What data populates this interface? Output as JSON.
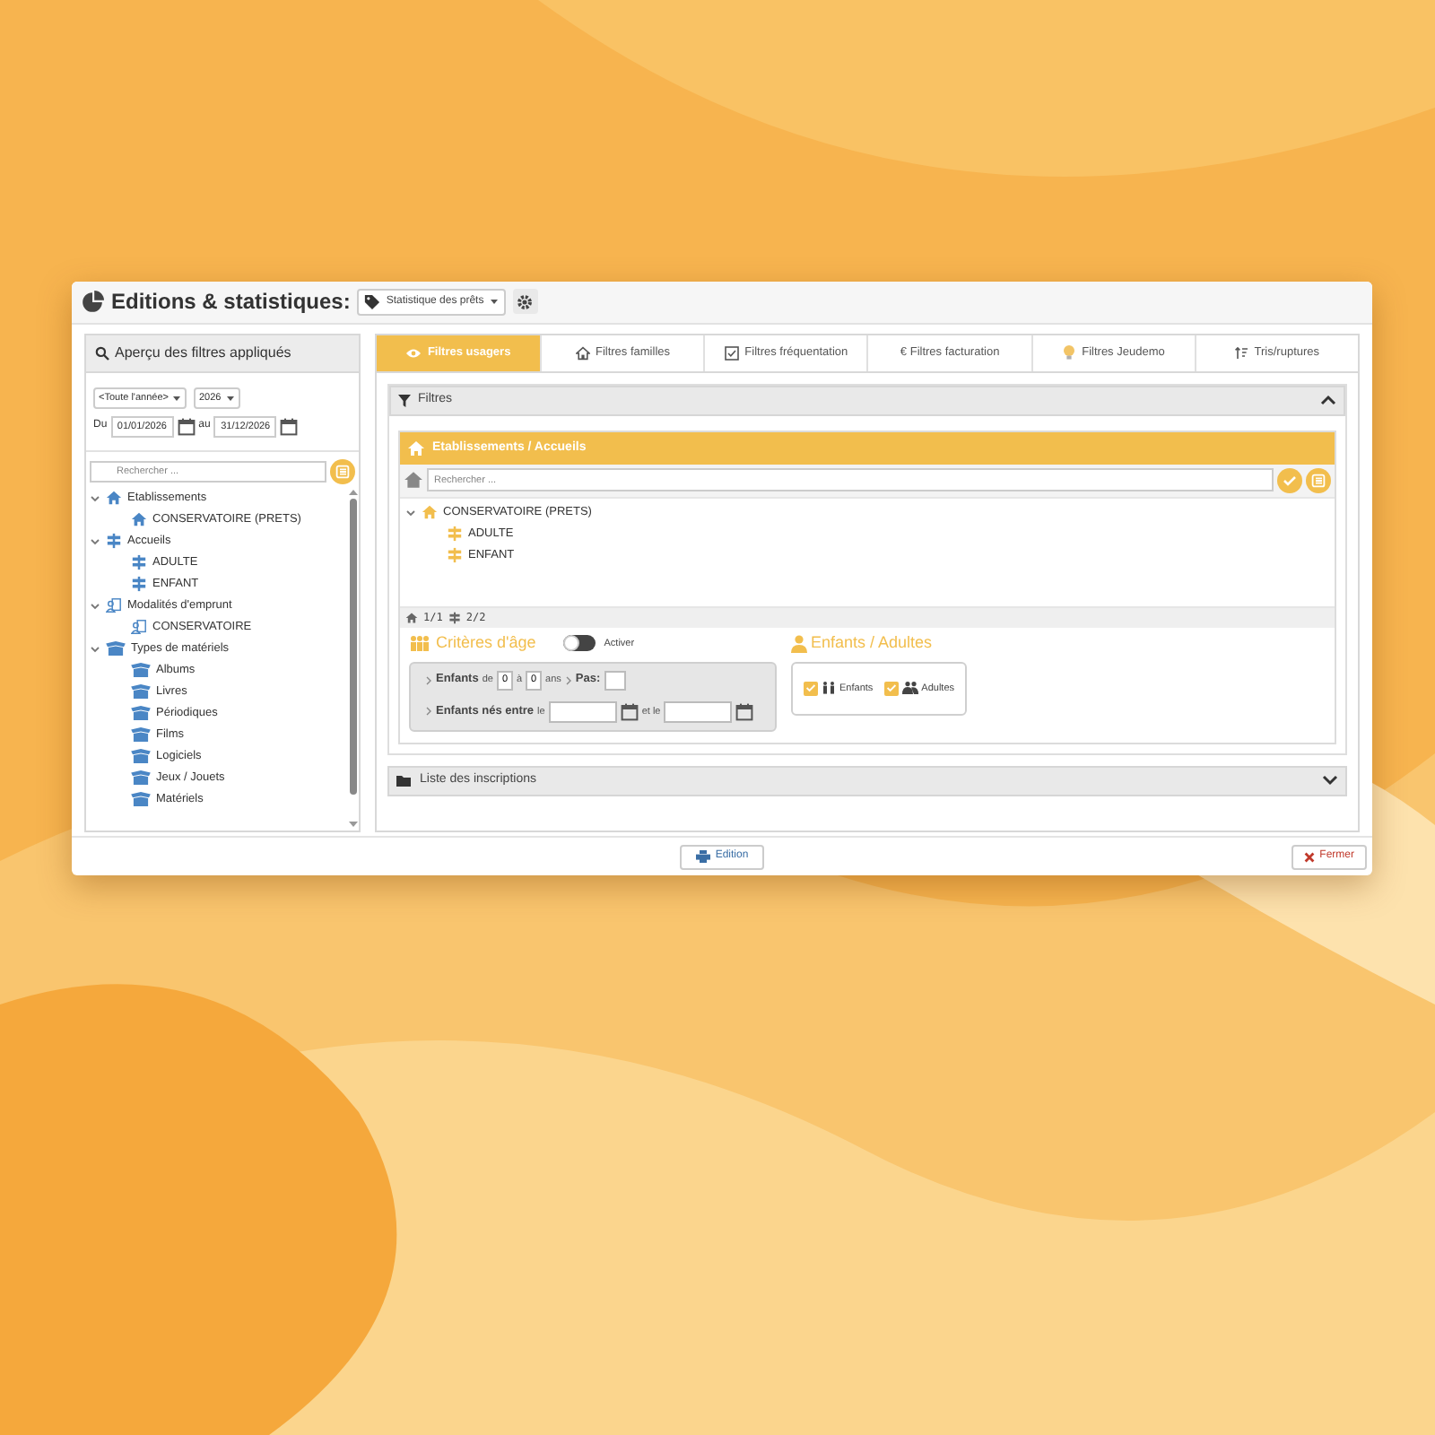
{
  "window": {
    "title": "Editions & statistiques:"
  },
  "report_select": {
    "value": "Statistique des prêts"
  },
  "filters_panel": {
    "title": "Aperçu des filtres appliqués",
    "period_select": {
      "value": "<Toute l'année>"
    },
    "year_select": {
      "value": "2026"
    },
    "from_label": "Du",
    "from_date": {
      "value": "01/01/2026"
    },
    "to_label": "au",
    "to_date": {
      "value": "31/12/2026"
    },
    "search": {
      "placeholder": "Rechercher ..."
    },
    "tree": [
      {
        "label": "Etablissements",
        "kind": "site",
        "expanded": true,
        "children": [
          {
            "label": "CONSERVATOIRE (PRETS)",
            "kind": "site"
          }
        ]
      },
      {
        "label": "Accueils",
        "kind": "reception",
        "expanded": true,
        "children": [
          {
            "label": "ADULTE",
            "kind": "reception"
          },
          {
            "label": "ENFANT",
            "kind": "reception"
          }
        ]
      },
      {
        "label": "Modalités d'emprunt",
        "kind": "loan",
        "expanded": true,
        "children": [
          {
            "label": "CONSERVATOIRE",
            "kind": "loan"
          }
        ]
      },
      {
        "label": "Types de matériels",
        "kind": "material",
        "expanded": true,
        "children": [
          {
            "label": "Albums",
            "kind": "material"
          },
          {
            "label": "Livres",
            "kind": "material"
          },
          {
            "label": "Périodiques",
            "kind": "material"
          },
          {
            "label": "Films",
            "kind": "material"
          },
          {
            "label": "Logiciels",
            "kind": "material"
          },
          {
            "label": "Jeux / Jouets",
            "kind": "material"
          },
          {
            "label": "Matériels",
            "kind": "material"
          }
        ]
      }
    ]
  },
  "tabs": [
    {
      "label": "Filtres usagers",
      "kind": "eye",
      "selected": true
    },
    {
      "label": "Filtres familles",
      "kind": "house",
      "selected": false
    },
    {
      "label": "Filtres fréquentation",
      "kind": "check",
      "selected": false
    },
    {
      "label": "€ Filtres facturation",
      "kind": "text",
      "selected": false
    },
    {
      "label": "Filtres Jeudemo",
      "kind": "bulb",
      "selected": false
    },
    {
      "label": "Tris/ruptures",
      "kind": "sort",
      "selected": false
    }
  ],
  "filters_section": {
    "title": "Filtres",
    "expanded": true
  },
  "establishments": {
    "title": "Etablissements / Accueils",
    "search": {
      "placeholder": "Rechercher ..."
    },
    "tree": [
      {
        "label": "CONSERVATOIRE (PRETS)",
        "kind": "site",
        "expanded": true,
        "children": [
          {
            "label": "ADULTE",
            "kind": "reception"
          },
          {
            "label": "ENFANT",
            "kind": "reception"
          }
        ]
      }
    ],
    "counts": [
      {
        "kind": "site",
        "text": "1/1"
      },
      {
        "kind": "reception",
        "text": "2/2"
      }
    ]
  },
  "age_criteria": {
    "title": "Critères d'âge",
    "toggle": {
      "label": "Activer",
      "on": false
    },
    "age_range": {
      "label": "Enfants",
      "from_label": "de",
      "from": "0",
      "to_label": "à",
      "to": "0",
      "unit": "ans",
      "step_label": "Pas:"
    },
    "birth_range": {
      "label": "Enfants nés entre",
      "from_label": "le",
      "to_label": "et le"
    }
  },
  "audience": {
    "title": "Enfants / Adultes",
    "options": [
      {
        "label": "Enfants",
        "kind": "children",
        "checked": true
      },
      {
        "label": "Adultes",
        "kind": "adults",
        "checked": true
      }
    ]
  },
  "registrations_section": {
    "title": "Liste des inscriptions",
    "expanded": false
  },
  "footer": {
    "print_button": "Edition",
    "close_button": "Fermer"
  }
}
